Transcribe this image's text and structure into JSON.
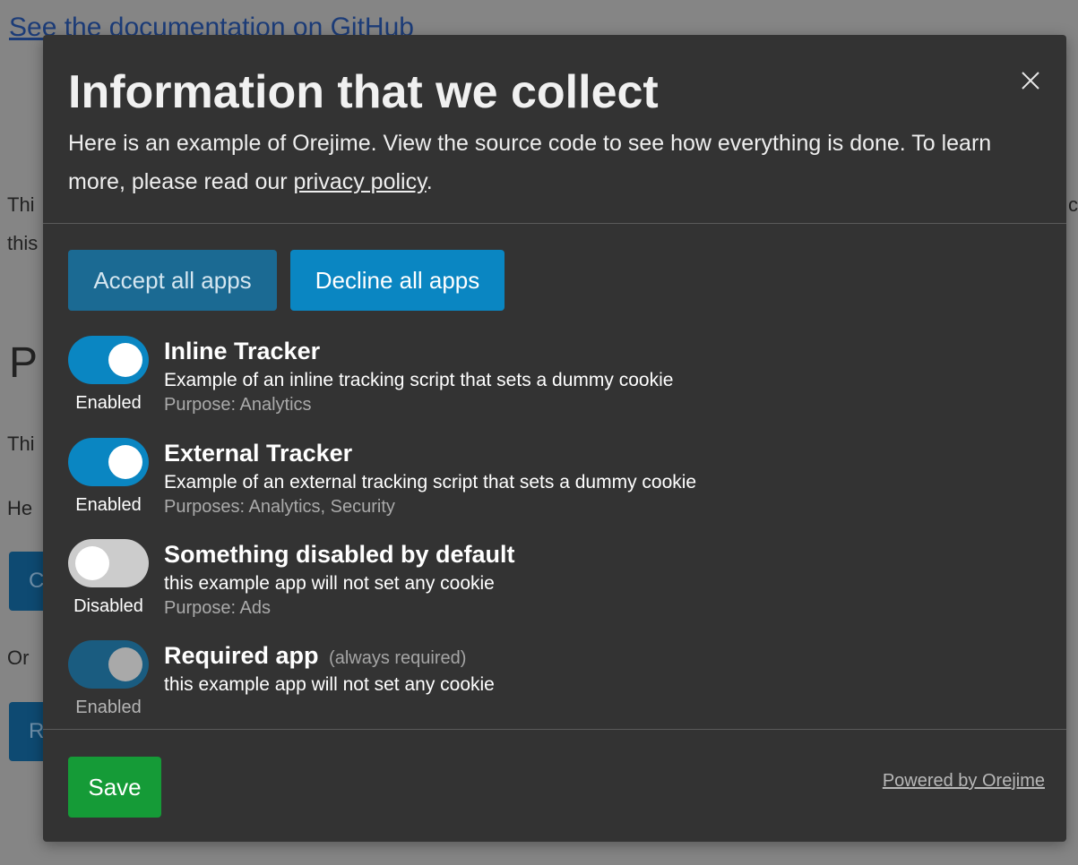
{
  "background": {
    "doc_link": "See the documentation on GitHub",
    "fragments": {
      "row1_left": "Thi",
      "row1_right": "c",
      "row2_left": "this",
      "heading": "P",
      "row3_left": "Thi",
      "row4_left": "He",
      "button1": "C",
      "row5_left": "Or",
      "button2": "R"
    }
  },
  "modal": {
    "title": "Information that we collect",
    "description_prefix": "Here is an example of Orejime. View the source code to see how everything is done. To learn more, please read our ",
    "privacy_link": "privacy policy",
    "description_suffix": ".",
    "close_icon": "close-icon",
    "accept_all_label": "Accept all apps",
    "decline_all_label": "Decline all apps",
    "apps": [
      {
        "title": "Inline Tracker",
        "description": "Example of an inline tracking script that sets a dummy cookie",
        "purpose": "Purpose: Analytics",
        "state_label": "Enabled"
      },
      {
        "title": "External Tracker",
        "description": "Example of an external tracking script that sets a dummy cookie",
        "purpose": "Purposes: Analytics, Security",
        "state_label": "Enabled"
      },
      {
        "title": "Something disabled by default",
        "description": "this example app will not set any cookie",
        "purpose": "Purpose: Ads",
        "state_label": "Disabled"
      },
      {
        "title": "Required app",
        "required_note": "(always required)",
        "description": "this example app will not set any cookie",
        "state_label": "Enabled"
      }
    ],
    "save_label": "Save",
    "powered_by": "Powered by Orejime"
  },
  "colors": {
    "overlay": "#858585",
    "modal_bg": "#333333",
    "primary": "#0a86c2",
    "save": "#159b37"
  }
}
